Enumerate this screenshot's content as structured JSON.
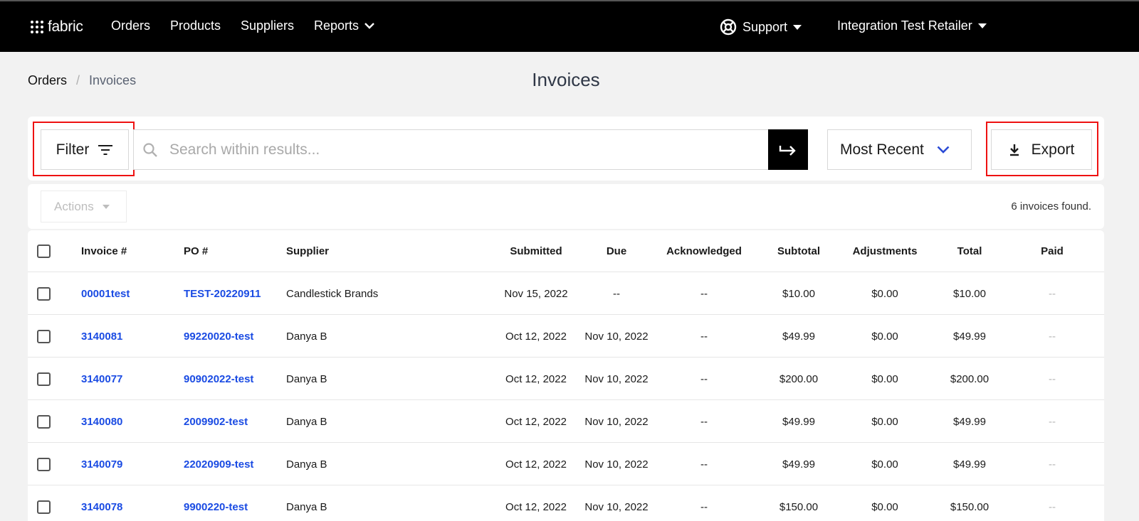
{
  "nav": {
    "logo_text": "fabric",
    "items": [
      "Orders",
      "Products",
      "Suppliers",
      "Reports"
    ],
    "support_label": "Support",
    "account_label": "Integration Test Retailer"
  },
  "breadcrumb": {
    "root": "Orders",
    "separator": "/",
    "current": "Invoices"
  },
  "page_title": "Invoices",
  "toolbar": {
    "filter_label": "Filter",
    "search_placeholder": "Search within results...",
    "sort_label": "Most Recent",
    "export_label": "Export"
  },
  "actions": {
    "label": "Actions",
    "count_text": "6 invoices found."
  },
  "table": {
    "headers": {
      "invoice": "Invoice #",
      "po": "PO #",
      "supplier": "Supplier",
      "submitted": "Submitted",
      "due": "Due",
      "acknowledged": "Acknowledged",
      "subtotal": "Subtotal",
      "adjustments": "Adjustments",
      "total": "Total",
      "paid": "Paid"
    },
    "rows": [
      {
        "invoice": "00001test",
        "po": "TEST-20220911",
        "supplier": "Candlestick Brands",
        "submitted": "Nov 15, 2022",
        "due": "--",
        "acknowledged": "--",
        "subtotal": "$10.00",
        "adjustments": "$0.00",
        "total": "$10.00",
        "paid": "--"
      },
      {
        "invoice": "3140081",
        "po": "99220020-test",
        "supplier": "Danya B",
        "submitted": "Oct 12, 2022",
        "due": "Nov 10, 2022",
        "acknowledged": "--",
        "subtotal": "$49.99",
        "adjustments": "$0.00",
        "total": "$49.99",
        "paid": "--"
      },
      {
        "invoice": "3140077",
        "po": "90902022-test",
        "supplier": "Danya B",
        "submitted": "Oct 12, 2022",
        "due": "Nov 10, 2022",
        "acknowledged": "--",
        "subtotal": "$200.00",
        "adjustments": "$0.00",
        "total": "$200.00",
        "paid": "--"
      },
      {
        "invoice": "3140080",
        "po": "2009902-test",
        "supplier": "Danya B",
        "submitted": "Oct 12, 2022",
        "due": "Nov 10, 2022",
        "acknowledged": "--",
        "subtotal": "$49.99",
        "adjustments": "$0.00",
        "total": "$49.99",
        "paid": "--"
      },
      {
        "invoice": "3140079",
        "po": "22020909-test",
        "supplier": "Danya B",
        "submitted": "Oct 12, 2022",
        "due": "Nov 10, 2022",
        "acknowledged": "--",
        "subtotal": "$49.99",
        "adjustments": "$0.00",
        "total": "$49.99",
        "paid": "--"
      },
      {
        "invoice": "3140078",
        "po": "9900220-test",
        "supplier": "Danya B",
        "submitted": "Oct 12, 2022",
        "due": "Nov 10, 2022",
        "acknowledged": "--",
        "subtotal": "$150.00",
        "adjustments": "$0.00",
        "total": "$150.00",
        "paid": "--"
      }
    ]
  }
}
